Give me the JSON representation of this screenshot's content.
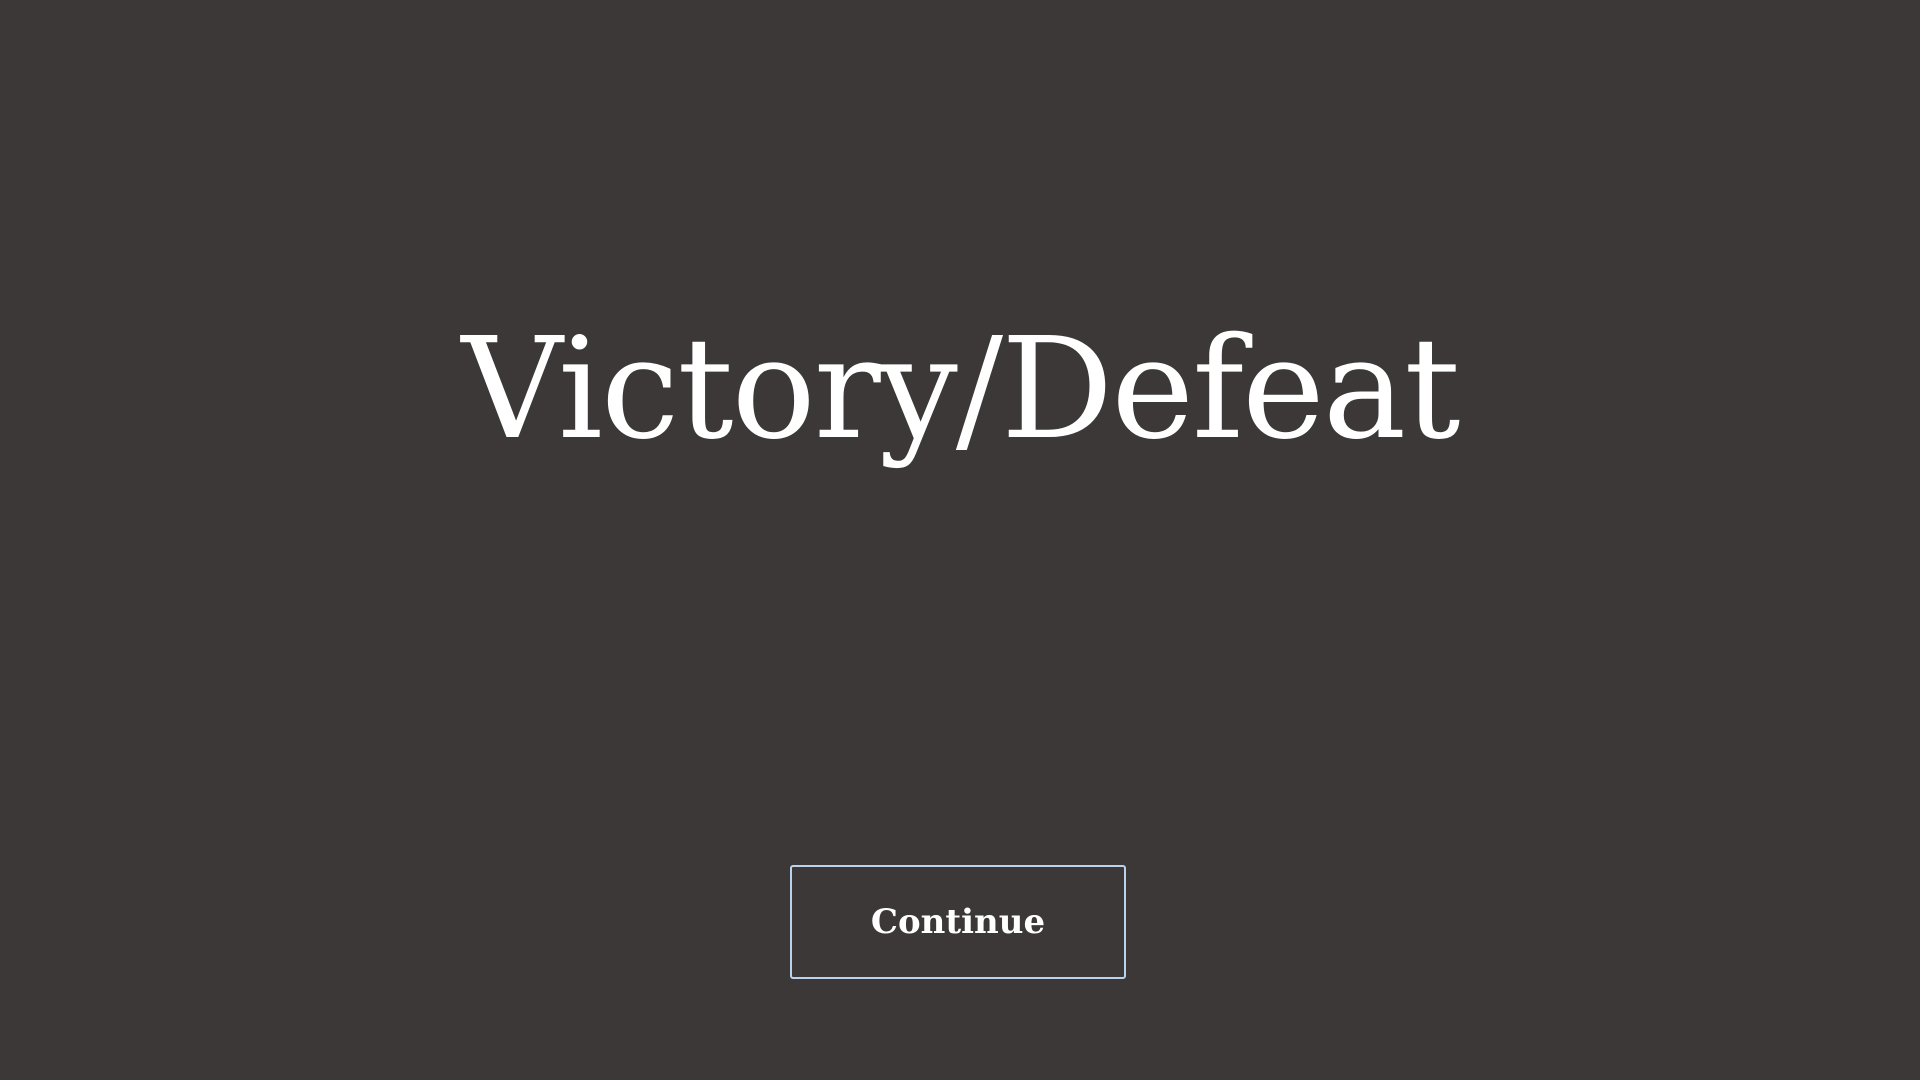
{
  "screen": {
    "title": "Victory/Defeat",
    "background_color": "#3c3837"
  },
  "actions": {
    "continue_label": "Continue",
    "button_border_color": "#b9d3ec"
  }
}
